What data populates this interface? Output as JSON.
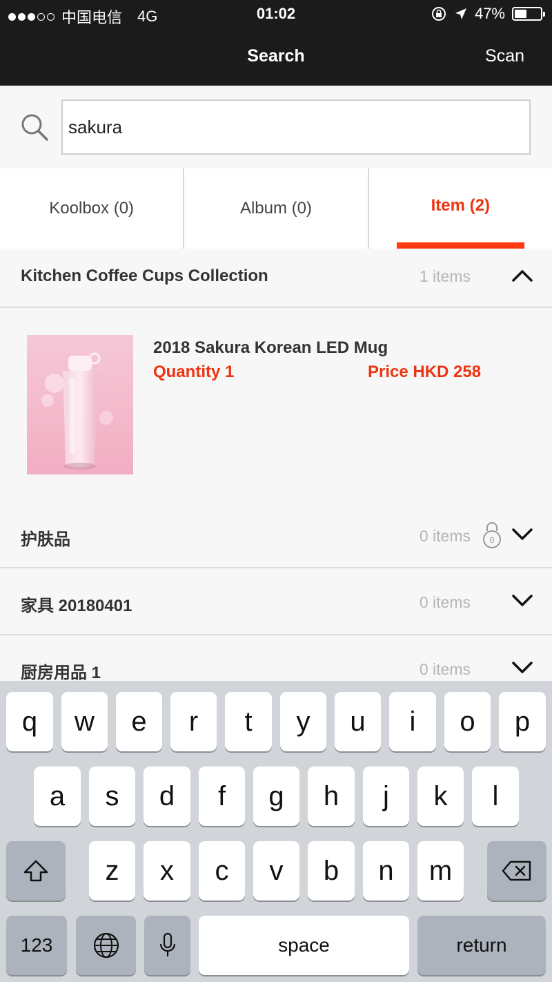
{
  "status_bar": {
    "carrier": "中国电信",
    "network": "4G",
    "time": "01:02",
    "battery": "47%",
    "battery_level": 0.47,
    "signal_bars": 3,
    "icons": [
      "rotation-lock-icon",
      "location-arrow-icon",
      "battery-icon"
    ]
  },
  "nav": {
    "title": "Search",
    "right_action": "Scan"
  },
  "search": {
    "value": "sakura",
    "placeholder": ""
  },
  "tabs": [
    {
      "label": "Koolbox (0)",
      "active": false
    },
    {
      "label": "Album (0)",
      "active": false
    },
    {
      "label": "Item (2)",
      "active": true
    }
  ],
  "collections": [
    {
      "name": "Kitchen Coffee Cups Collection",
      "count": "1 items",
      "expanded": true,
      "locked": false
    },
    {
      "name": "护肤品",
      "count": "0 items",
      "expanded": false,
      "locked": true
    },
    {
      "name": "家具 20180401",
      "count": "0 items",
      "expanded": false,
      "locked": false
    },
    {
      "name": "厨房用品 1",
      "count": "0 items",
      "expanded": false,
      "locked": false
    }
  ],
  "item": {
    "title": "2018 Sakura Korean LED Mug",
    "quantity": "Quantity 1",
    "price": "Price HKD 258"
  },
  "keyboard": {
    "row1": [
      "q",
      "w",
      "e",
      "r",
      "t",
      "y",
      "u",
      "i",
      "o",
      "p"
    ],
    "row2": [
      "a",
      "s",
      "d",
      "f",
      "g",
      "h",
      "j",
      "k",
      "l"
    ],
    "row3": [
      "z",
      "x",
      "c",
      "v",
      "b",
      "n",
      "m"
    ],
    "numbers_key": "123",
    "space_key": "space",
    "return_key": "return"
  },
  "colors": {
    "accent": "#ee3311",
    "navbar": "#1b1b1b",
    "keyboard_bg": "#d1d4d9"
  }
}
